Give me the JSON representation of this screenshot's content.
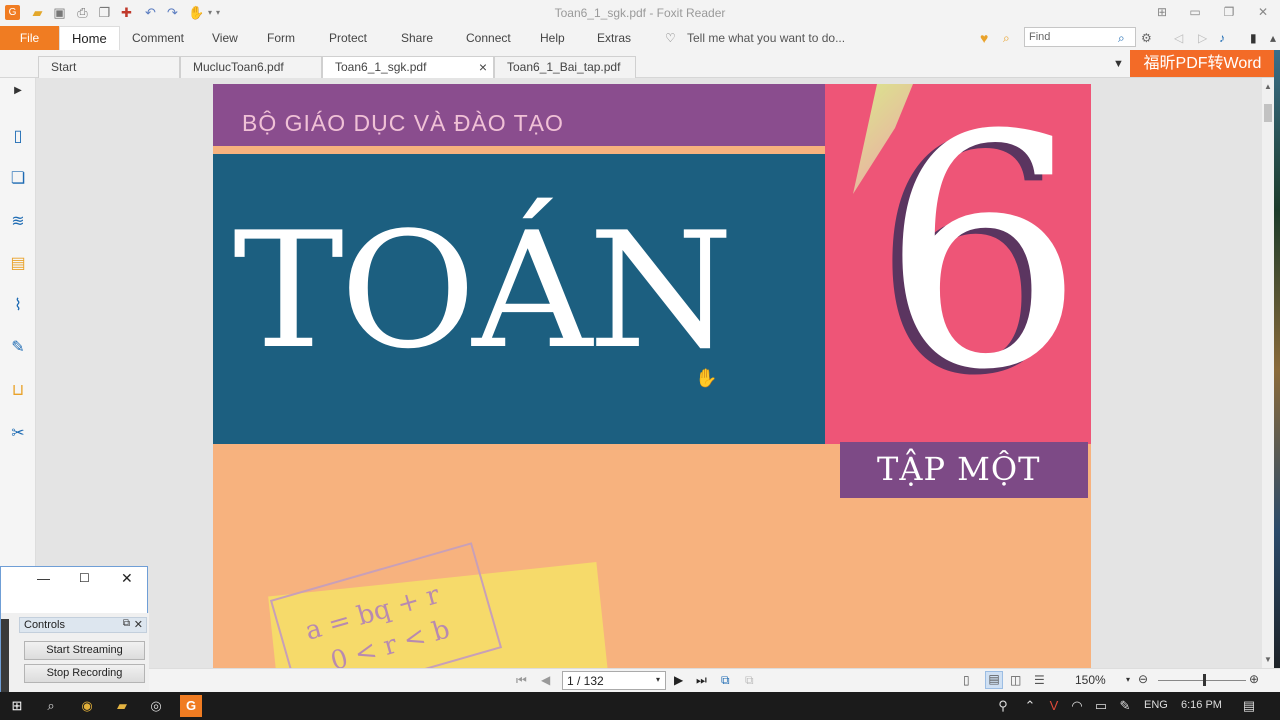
{
  "window": {
    "title": "Toan6_1_sgk.pdf - Foxit Reader"
  },
  "ribbon": {
    "file": "File",
    "tabs": [
      "Home",
      "Comment",
      "View",
      "Form",
      "Protect",
      "Share",
      "Connect",
      "Help",
      "Extras"
    ],
    "tell_me": "Tell me what you want to do...",
    "find_placeholder": "Find"
  },
  "doc_tabs": {
    "start": "Start",
    "tabs": [
      "MuclucToan6.pdf",
      "Toan6_1_sgk.pdf",
      "Toan6_1_Bai_tap.pdf"
    ],
    "close_glyph": "×"
  },
  "promo": "福昕PDF转Word",
  "pdf_page": {
    "ministry": "BỘ GIÁO DỤC VÀ ĐÀO TẠO",
    "subject": "TOÁN",
    "grade": "6",
    "volume": "TẬP MỘT",
    "formula1": "a = bq + r",
    "formula2": "0 < r < b"
  },
  "controls_window": {
    "panel_title": "Controls",
    "start_streaming": "Start Streaming",
    "stop_recording": "Stop Recording"
  },
  "statusbar": {
    "page": "1 / 132",
    "zoom": "150%"
  },
  "taskbar": {
    "lang": "ENG",
    "time": "6:16 PM"
  },
  "colors": {
    "accent": "#f07c22",
    "brand_orange": "#f36b27"
  }
}
